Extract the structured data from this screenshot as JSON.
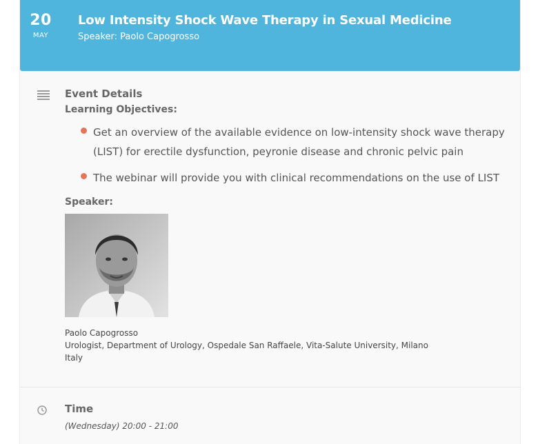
{
  "event": {
    "day": "20",
    "month": "MAY",
    "title": "Low Intensity Shock Wave Therapy in Sexual Medicine",
    "speaker_line": "Speaker: Paolo Capogrosso"
  },
  "details": {
    "heading": "Event Details",
    "objectives_heading": "Learning Objectives:",
    "objectives": [
      "Get an overview of the available evidence on low-intensity shock wave therapy (LIST) for erectile dysfunction, peyronie disease and chronic pelvic pain",
      "The webinar will provide you with clinical recommendations on the use of LIST"
    ],
    "speaker_heading": "Speaker:",
    "speaker": {
      "name": "Paolo Capogrosso",
      "affiliation": "Urologist, Department of Urology, Ospedale San Raffaele, Vita-Salute University, Milano",
      "country": "Italy"
    }
  },
  "time": {
    "heading": "Time",
    "value": "(Wednesday) 20:00 - 21:00"
  },
  "colors": {
    "header_bg": "#4fb5dc",
    "bullet": "#e8735a"
  },
  "icons": [
    "details-icon",
    "clock-icon"
  ]
}
